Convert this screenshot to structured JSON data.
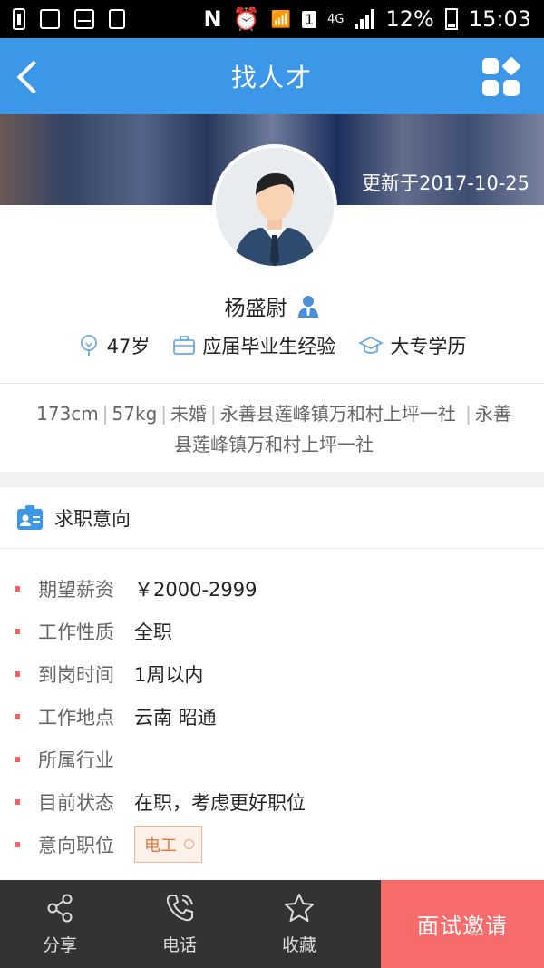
{
  "status_bar": {
    "carrier_icon": "N",
    "sim": "1",
    "network": "4G",
    "battery": "12%",
    "time": "15:03"
  },
  "header": {
    "title": "找人才",
    "back_icon": "back-arrow-icon",
    "menu_icon": "apps-grid-icon"
  },
  "profile": {
    "updated": "更新于2017-10-25",
    "name": "杨盛尉",
    "age": "47岁",
    "experience": "应届毕业生经验",
    "education": "大专学历",
    "height": "173cm",
    "weight": "57kg",
    "marital": "未婚",
    "address1": "永善县莲峰镇万和村上坪一社",
    "address2": "永善",
    "address2_cont": "县莲峰镇万和村上坪一社"
  },
  "intention": {
    "title": "求职意向",
    "rows": [
      {
        "label": "期望薪资",
        "value": "￥2000-2999"
      },
      {
        "label": "工作性质",
        "value": "全职"
      },
      {
        "label": "到岗时间",
        "value": "1周以内"
      },
      {
        "label": "工作地点",
        "value": "云南 昭通"
      },
      {
        "label": "所属行业",
        "value": ""
      },
      {
        "label": "目前状态",
        "value": "在职，考虑更好职位"
      },
      {
        "label": "意向职位",
        "value": ""
      }
    ],
    "job_tag": "电工"
  },
  "bottom": {
    "share": "分享",
    "phone": "电话",
    "favorite": "收藏",
    "invite": "面试邀请"
  },
  "colors": {
    "header_blue": "#3d97e8",
    "invite_red": "#f86b6b",
    "accent_dot": "#f06363",
    "chip_orange": "#e2773a"
  }
}
